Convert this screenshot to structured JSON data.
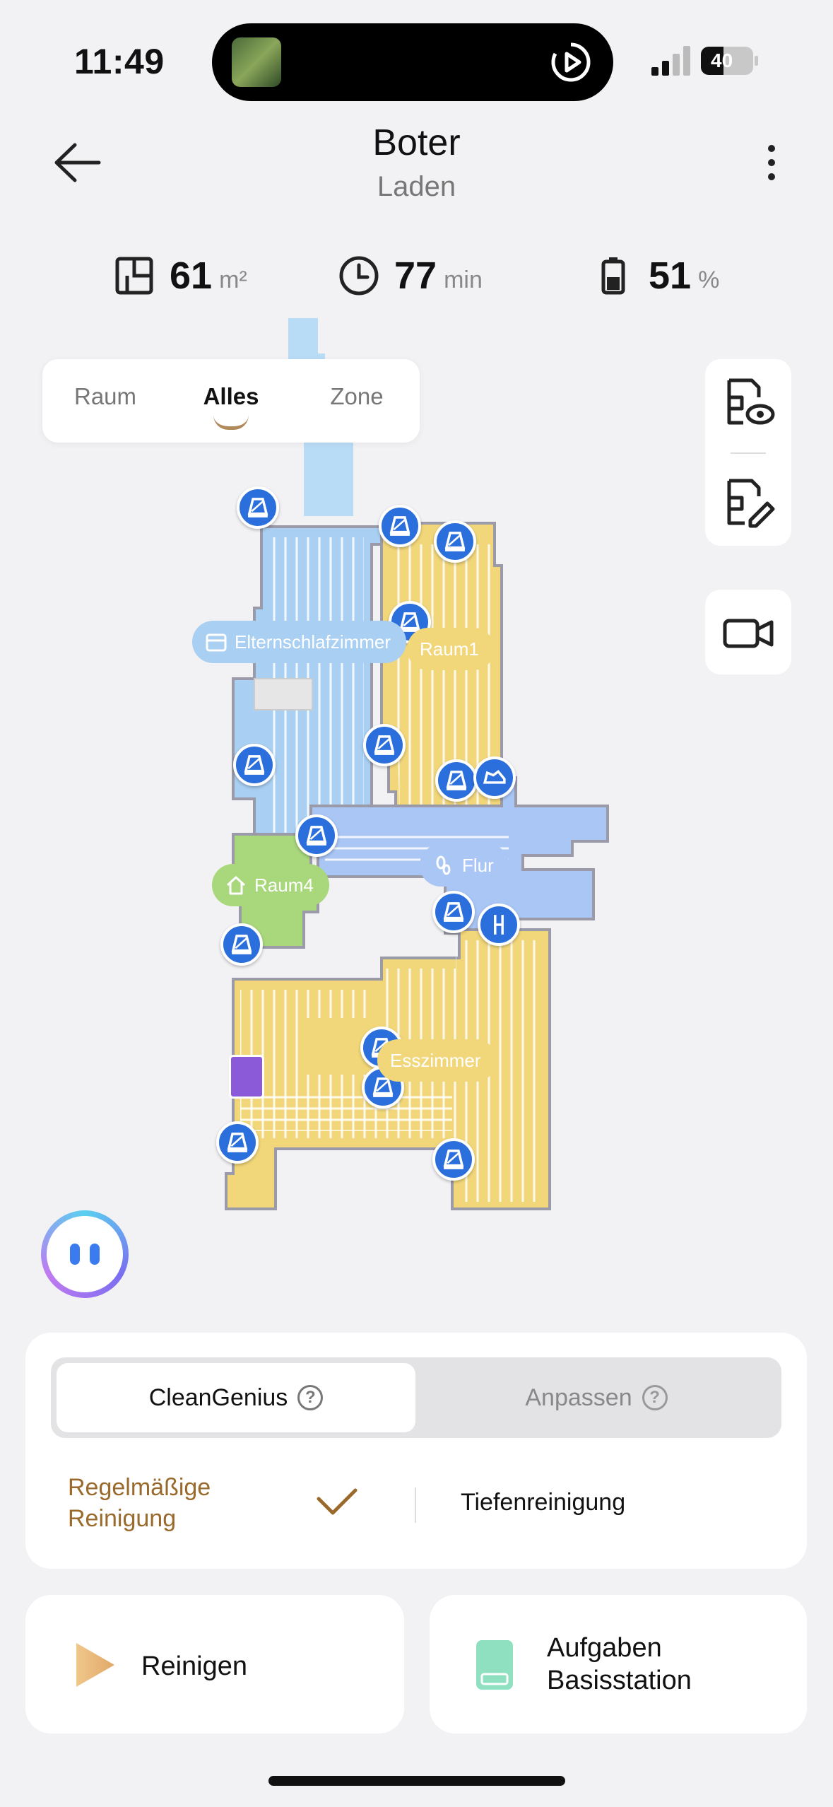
{
  "status_bar": {
    "time": "11:49",
    "battery": "40"
  },
  "header": {
    "title": "Boter",
    "subtitle": "Laden",
    "back_icon": "arrow-left-icon",
    "more_icon": "more-vertical-icon"
  },
  "stats": {
    "area": {
      "value": "61",
      "unit": "m²",
      "icon": "floorplan-icon"
    },
    "time": {
      "value": "77",
      "unit": "min",
      "icon": "clock-icon"
    },
    "battery": {
      "value": "51",
      "unit": "%",
      "icon": "battery-icon"
    }
  },
  "mode_tabs": [
    "Raum",
    "Alles",
    "Zone"
  ],
  "mode_active": "Alles",
  "map": {
    "rooms": [
      {
        "label": "Elternschlafzimmer",
        "color": "#a9cff2",
        "icon": "bed-icon"
      },
      {
        "label": "Raum1",
        "color": "#f2d77a",
        "icon": "none"
      },
      {
        "label": "Flur",
        "color": "#a9c6f5",
        "icon": "footprint-icon"
      },
      {
        "label": "Raum4",
        "color": "#a9d77c",
        "icon": "house-icon"
      },
      {
        "label": "Esszimmer",
        "color": "#f2d77a",
        "icon": "none"
      }
    ]
  },
  "panel": {
    "tab_cleangenius": "CleanGenius",
    "tab_customize": "Anpassen",
    "regular_line1": "Regelmäßige",
    "regular_line2": "Reinigung",
    "deep": "Tiefenreinigung"
  },
  "actions": {
    "start": "Reinigen",
    "base_line1": "Aufgaben",
    "base_line2": "Basisstation"
  },
  "colors": {
    "accent_brown": "#9a6a2c",
    "marker_blue": "#2a6fdb",
    "room_blue": "#a9cff2",
    "room_yellow": "#f2d77a",
    "room_green": "#a9d77c"
  }
}
